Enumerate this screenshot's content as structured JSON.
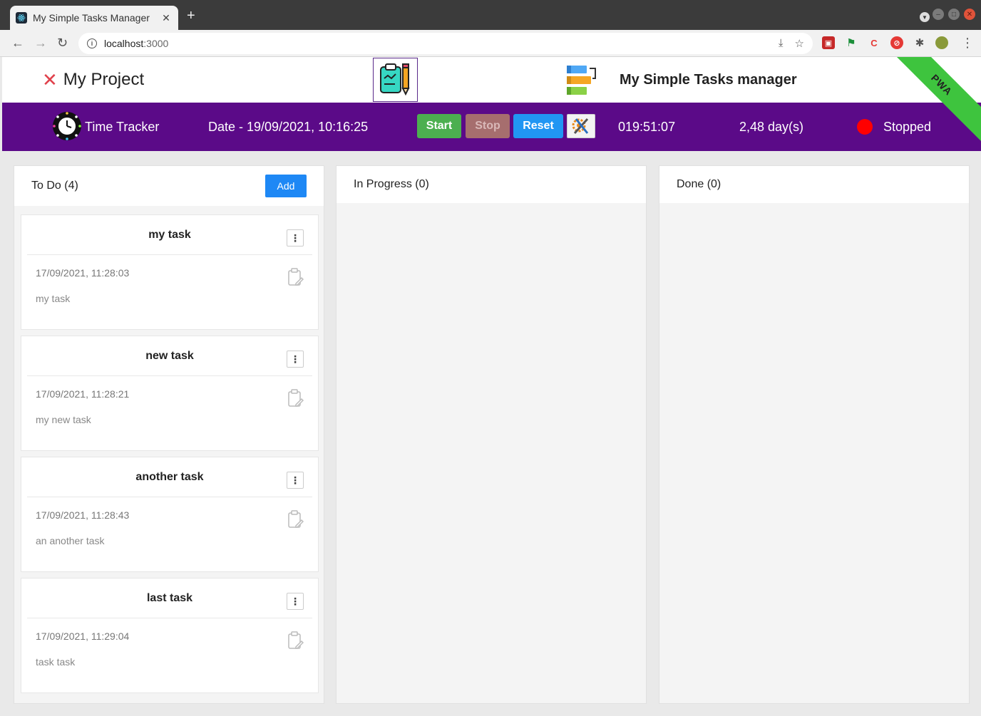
{
  "browser": {
    "tab_title": "My Simple Tasks Manager",
    "tab_close": "✕",
    "new_tab": "+",
    "url_host": "localhost",
    "url_port": ":3000"
  },
  "header": {
    "project_title": "My Project",
    "app_title": "My Simple Tasks manager",
    "ribbon_text": "PWA"
  },
  "tracker": {
    "label": "Time Tracker",
    "date": "Date - 19/09/2021, 10:16:25",
    "start_label": "Start",
    "stop_label": "Stop",
    "reset_label": "Reset",
    "elapsed": "019:51:07",
    "days": "2,48 day(s)",
    "status": "Stopped",
    "status_color": "#ff0000"
  },
  "columns": [
    {
      "title": "To Do (4)",
      "add_label": "Add"
    },
    {
      "title": "In Progress (0)"
    },
    {
      "title": "Done (0)"
    }
  ],
  "tasks": [
    {
      "title": "my task",
      "date": "17/09/2021, 11:28:03",
      "desc": "my task",
      "menu": "⋮"
    },
    {
      "title": "new task",
      "date": "17/09/2021, 11:28:21",
      "desc": "my new task",
      "menu": "⋮"
    },
    {
      "title": "another task",
      "date": "17/09/2021, 11:28:43",
      "desc": "an another task",
      "menu": "⋮"
    },
    {
      "title": "last task",
      "date": "17/09/2021, 11:29:04",
      "desc": "task task",
      "menu": "⋮"
    }
  ],
  "colors": {
    "tracker_bg": "#5b0a88",
    "start": "#4caf50",
    "stop": "#a66e6e",
    "reset": "#2196f3",
    "add": "#1e88f5",
    "ribbon": "#3ec43e"
  }
}
